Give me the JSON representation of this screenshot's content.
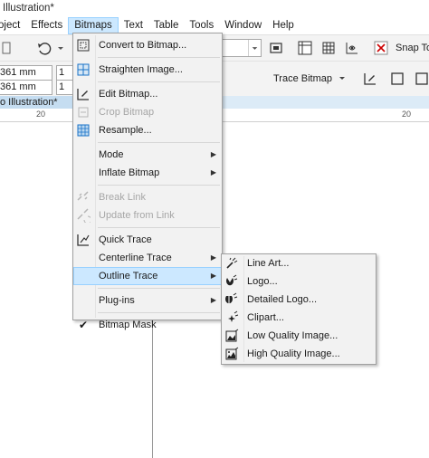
{
  "window": {
    "title": "Illustration*"
  },
  "menubar": {
    "items": [
      {
        "label": "oject"
      },
      {
        "label": "Effects"
      },
      {
        "label": "Bitmaps"
      },
      {
        "label": "Text"
      },
      {
        "label": "Table"
      },
      {
        "label": "Tools"
      },
      {
        "label": "Window"
      },
      {
        "label": "Help"
      }
    ]
  },
  "toolbar": {
    "snap_label": "Snap To",
    "width_value": "361 mm",
    "height_value": "361 mm",
    "field_one": "1",
    "field_two": "1",
    "trace_bitmap_label": "Trace Bitmap"
  },
  "document": {
    "tab_label": "o Illustration*",
    "ruler_mark": "20",
    "ruler_mark2": "20"
  },
  "bitmaps_menu": {
    "items": [
      {
        "label": "Convert to Bitmap..."
      },
      {
        "label": "Straighten Image..."
      },
      {
        "label": "Edit Bitmap..."
      },
      {
        "label": "Crop Bitmap"
      },
      {
        "label": "Resample..."
      },
      {
        "label": "Mode"
      },
      {
        "label": "Inflate Bitmap"
      },
      {
        "label": "Break Link"
      },
      {
        "label": "Update from Link"
      },
      {
        "label": "Quick Trace"
      },
      {
        "label": "Centerline Trace"
      },
      {
        "label": "Outline Trace"
      },
      {
        "label": "Plug-ins"
      },
      {
        "label": "Bitmap Mask"
      }
    ]
  },
  "outline_trace_menu": {
    "items": [
      {
        "label": "Line Art..."
      },
      {
        "label": "Logo..."
      },
      {
        "label": "Detailed Logo..."
      },
      {
        "label": "Clipart..."
      },
      {
        "label": "Low Quality Image..."
      },
      {
        "label": "High Quality Image..."
      }
    ]
  },
  "colors": {
    "highlight": "#cce8ff",
    "highlight_border": "#99d1ff",
    "menu_bg": "#f2f2f2",
    "accent_blue": "#1a73c8"
  }
}
